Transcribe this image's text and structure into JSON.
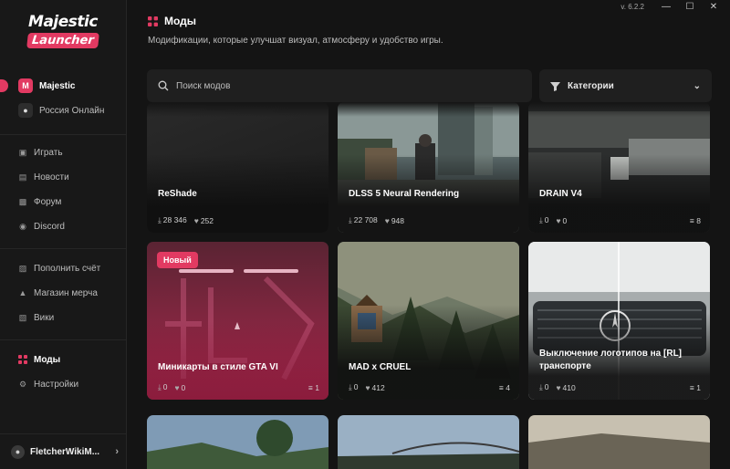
{
  "window": {
    "version": "v. 6.2.2"
  },
  "logo": {
    "top": "Majestic",
    "bottom": "Launcher"
  },
  "sidebar": {
    "servers": [
      {
        "label": "Majestic"
      },
      {
        "label": "Россия Онлайн"
      }
    ],
    "nav_main": [
      {
        "label": "Играть",
        "icon": "gamepad-icon"
      },
      {
        "label": "Новости",
        "icon": "newspaper-icon"
      },
      {
        "label": "Форум",
        "icon": "chat-icon"
      },
      {
        "label": "Discord",
        "icon": "discord-icon"
      }
    ],
    "nav_shop": [
      {
        "label": "Пополнить счёт",
        "icon": "wallet-icon"
      },
      {
        "label": "Магазин мерча",
        "icon": "shirt-icon"
      },
      {
        "label": "Вики",
        "icon": "book-icon"
      }
    ],
    "nav_bottom": [
      {
        "label": "Моды",
        "icon": "mods-icon"
      },
      {
        "label": "Настройки",
        "icon": "gear-icon"
      }
    ],
    "user": {
      "name": "FletcherWikiM..."
    }
  },
  "header": {
    "title": "Моды",
    "subtitle": "Модификации, которые улучшат визуал, атмосферу и удобство игры."
  },
  "search": {
    "placeholder": "Поиск модов"
  },
  "filter": {
    "label": "Категории"
  },
  "cards": [
    {
      "name": "ReShade",
      "downloads": "28 346",
      "likes": "252",
      "versions": ""
    },
    {
      "name": "DLSS 5 Neural Rendering",
      "downloads": "22 708",
      "likes": "948",
      "versions": ""
    },
    {
      "name": "DRAIN V4",
      "downloads": "0",
      "likes": "0",
      "versions": "8"
    },
    {
      "name": "Миникарты в стиле GTA VI",
      "downloads": "0",
      "likes": "0",
      "versions": "1",
      "badge": "Новый"
    },
    {
      "name": "MAD x CRUEL",
      "downloads": "0",
      "likes": "412",
      "versions": "4"
    },
    {
      "name": "Выключение логотипов на [RL] транспорте",
      "downloads": "0",
      "likes": "410",
      "versions": "1"
    }
  ],
  "colors": {
    "accent": "#e23a62",
    "background": "#141414",
    "sidebar": "#181818",
    "panel": "#1f1f1f"
  }
}
